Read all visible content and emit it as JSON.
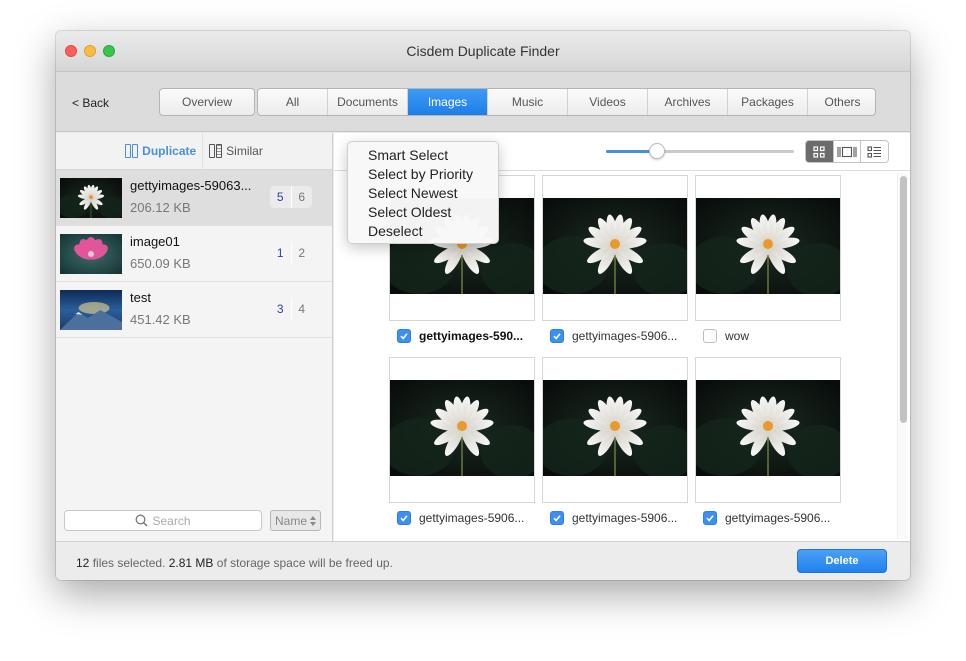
{
  "window": {
    "title": "Cisdem Duplicate Finder"
  },
  "toolbar": {
    "back_label": "< Back",
    "overview_label": "Overview",
    "tabs": [
      {
        "label": "All",
        "active": false
      },
      {
        "label": "Documents",
        "active": false
      },
      {
        "label": "Images",
        "active": true
      },
      {
        "label": "Music",
        "active": false
      },
      {
        "label": "Videos",
        "active": false
      },
      {
        "label": "Archives",
        "active": false
      },
      {
        "label": "Packages",
        "active": false
      },
      {
        "label": "Others",
        "active": false
      }
    ]
  },
  "sidebar": {
    "modes": [
      {
        "label": "Duplicate",
        "icon": "duplicate-icon",
        "active": true
      },
      {
        "label": "Similar",
        "icon": "similar-icon",
        "active": false
      }
    ],
    "groups": [
      {
        "name": "gettyimages-59063...",
        "size": "206.12 KB",
        "selected_count": "5",
        "total_count": "6",
        "thumb": "white-lotus",
        "selected": true
      },
      {
        "name": "image01",
        "size": "650.09 KB",
        "selected_count": "1",
        "total_count": "2",
        "thumb": "pink-lotus",
        "selected": false
      },
      {
        "name": "test",
        "size": "451.42 KB",
        "selected_count": "3",
        "total_count": "4",
        "thumb": "mountain-night",
        "selected": false
      }
    ],
    "search_placeholder": "Search",
    "sort_label": "Name"
  },
  "main": {
    "thumbnail_size_percent": 27,
    "view_modes": [
      {
        "icon": "grid-view-icon",
        "active": true
      },
      {
        "icon": "filmstrip-view-icon",
        "active": false
      },
      {
        "icon": "list-view-icon",
        "active": false
      }
    ],
    "select_menu": [
      "Smart Select",
      "Select by Priority",
      "Select Newest",
      "Select Oldest",
      "Deselect"
    ],
    "files": [
      {
        "name": "gettyimages-590...",
        "checked": true,
        "bold": true
      },
      {
        "name": "gettyimages-5906...",
        "checked": true,
        "bold": false
      },
      {
        "name": "wow",
        "checked": false,
        "bold": false
      },
      {
        "name": "gettyimages-5906...",
        "checked": true,
        "bold": false
      },
      {
        "name": "gettyimages-5906...",
        "checked": true,
        "bold": false
      },
      {
        "name": "gettyimages-5906...",
        "checked": true,
        "bold": false
      }
    ],
    "scroll_fraction_visible": 0.67
  },
  "status": {
    "count": "12",
    "count_suffix": " files selected. ",
    "size": "2.81 MB",
    "size_suffix": " of storage space will be freed up.",
    "delete_label": "Delete"
  },
  "colors": {
    "accent": "#1d7ee8",
    "checkbox": "#3b8ff5",
    "count_selected": "#2b3fb3"
  }
}
